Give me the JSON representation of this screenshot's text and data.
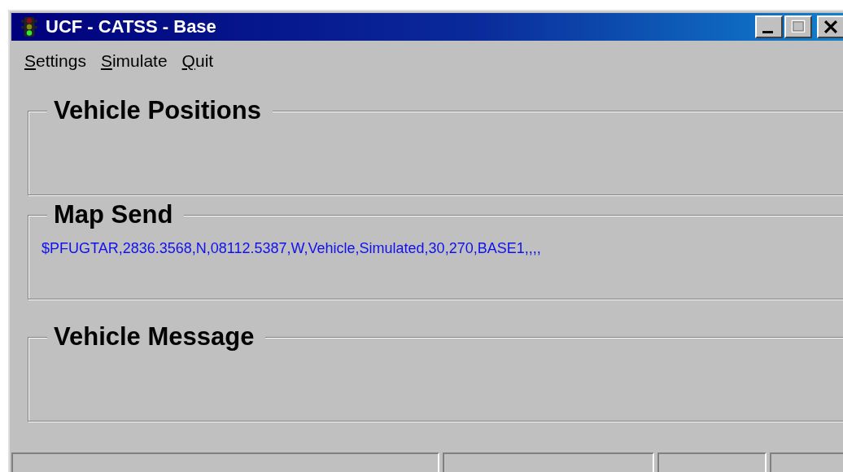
{
  "window": {
    "title": "UCF - CATSS - Base"
  },
  "menu": [
    {
      "label": "Settings"
    },
    {
      "label": "Simulate"
    },
    {
      "label": "Quit"
    }
  ],
  "groups": [
    {
      "title": "Vehicle Positions"
    },
    {
      "title": "Map Send",
      "text": "$PFUGTAR,2836.3568,N,08112.5387,W,Vehicle,Simulated,30,270,BASE1,,,,"
    },
    {
      "title": "Vehicle Message"
    }
  ]
}
